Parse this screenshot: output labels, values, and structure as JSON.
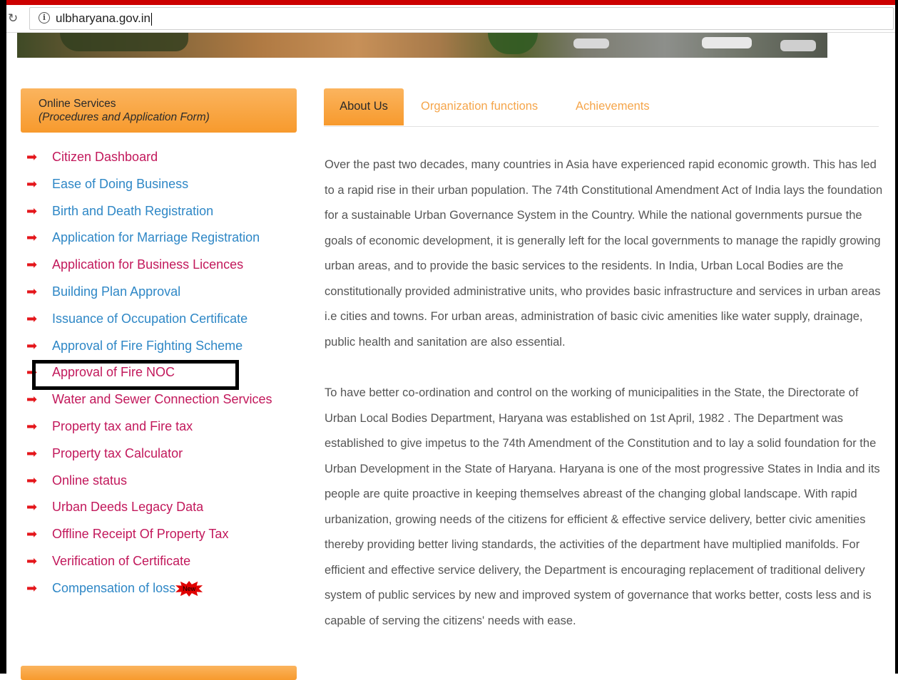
{
  "browser": {
    "reload_icon": "reload-icon",
    "info_icon_glyph": "i",
    "url": "ulbharyana.gov.in"
  },
  "services": {
    "title": "Online Services",
    "subtitle": "(Procedures and Application Form)",
    "bullet_glyph": "➡",
    "items": [
      {
        "label": "Citizen Dashboard",
        "color": "#c2185b"
      },
      {
        "label": "Ease of Doing Business",
        "color": "#2e87c6"
      },
      {
        "label": "Birth and Death Registration",
        "color": "#2e87c6"
      },
      {
        "label": "Application for Marriage Registration",
        "color": "#2e87c6"
      },
      {
        "label": "Application for Business Licences",
        "color": "#c2185b"
      },
      {
        "label": "Building Plan Approval",
        "color": "#2e87c6"
      },
      {
        "label": "Issuance of Occupation Certificate",
        "color": "#2e87c6"
      },
      {
        "label": "Approval of Fire Fighting Scheme",
        "color": "#2e87c6"
      },
      {
        "label": "Approval of Fire NOC",
        "color": "#c2185b"
      },
      {
        "label": "Water and Sewer Connection Services",
        "color": "#c2185b"
      },
      {
        "label": "Property tax and Fire tax",
        "color": "#c2185b"
      },
      {
        "label": "Property tax Calculator",
        "color": "#c2185b"
      },
      {
        "label": "Online status",
        "color": "#c2185b"
      },
      {
        "label": "Urban Deeds Legacy Data",
        "color": "#c2185b"
      },
      {
        "label": "Offline Receipt Of Property Tax",
        "color": "#c2185b"
      },
      {
        "label": "Verification of Certificate",
        "color": "#c2185b"
      },
      {
        "label": "Compensation of loss",
        "color": "#2e87c6",
        "badge": "New"
      }
    ]
  },
  "tabs": [
    {
      "label": "About Us",
      "active": true
    },
    {
      "label": "Organization functions",
      "active": false
    },
    {
      "label": "Achievements",
      "active": false
    }
  ],
  "about": {
    "paragraph1": "Over the past two decades, many countries in Asia have experienced rapid economic growth. This has led to a rapid rise in their urban population. The 74th Constitutional Amendment Act of India lays the foundation for a sustainable Urban Governance System in the Country. While the national governments pursue the goals of economic development, it is generally left for the local governments to manage the rapidly growing urban areas, and to provide the basic services to the residents. In India, Urban Local Bodies are the constitutionally provided administrative units, who provides basic infrastructure and services in urban areas i.e cities and towns. For urban areas, administration of basic civic amenities like water supply, drainage, public health and sanitation are also essential.",
    "paragraph2": "To have better co-ordination and control on the working of municipalities in the State, the Directorate of Urban Local Bodies Department, Haryana was established on 1st April, 1982 . The Department was established to give impetus to the 74th Amendment of the Constitution and to lay a solid foundation for the Urban Development in the State of Haryana. Haryana is one of the most progressive States in India and its people are quite proactive in keeping themselves abreast of the changing global landscape. With rapid urbanization, growing needs of the citizens for efficient & effective service delivery, better civic amenities thereby providing better living standards, the activities of the department have multiplied manifolds. For efficient and effective service delivery, the Department is encouraging replacement of traditional delivery system of public services by new and improved system of governance that works better, costs less and is capable of serving the citizens' needs with ease."
  },
  "colors": {
    "accent_orange": "#f79a2d",
    "link_red": "#c2185b",
    "link_blue": "#2e87c6",
    "bullet_red": "#e4161b",
    "top_bar_red": "#cc0000"
  }
}
